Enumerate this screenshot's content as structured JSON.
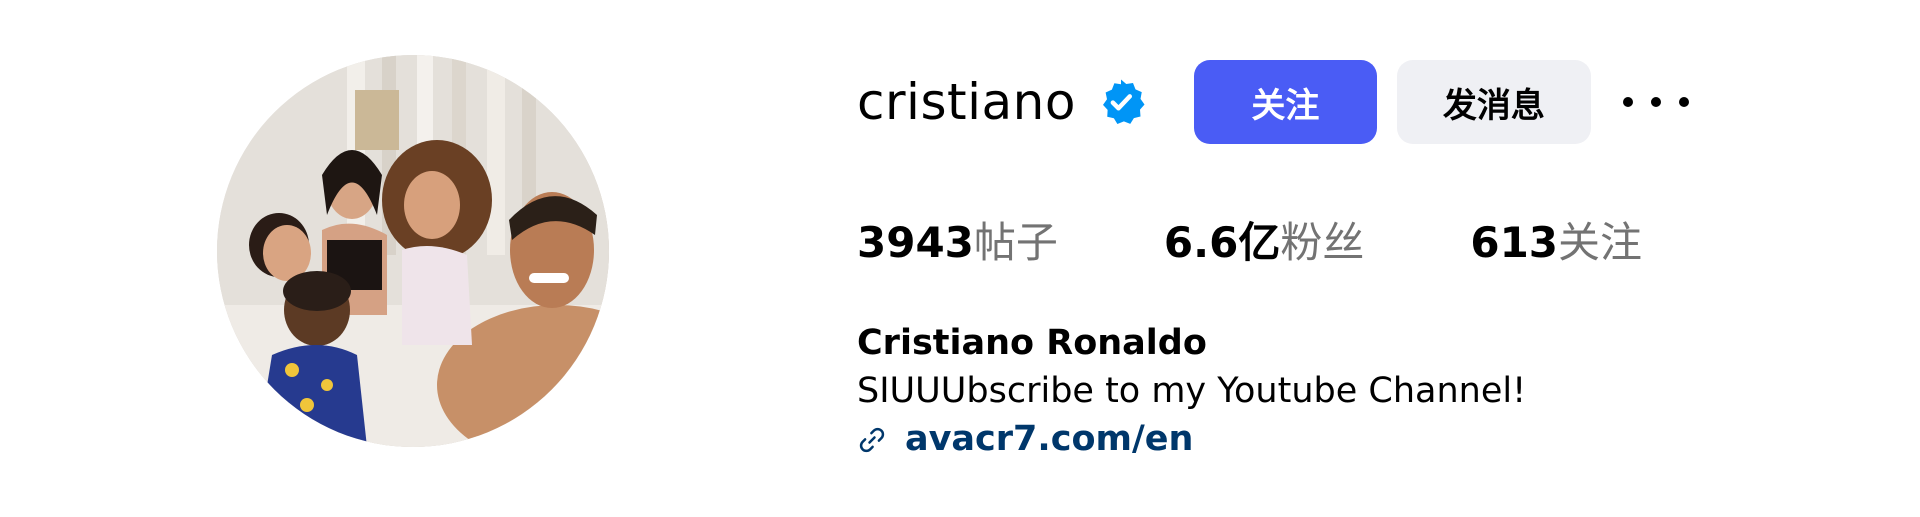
{
  "profile": {
    "username": "cristiano",
    "verified_icon": "verified-badge-icon",
    "follow_label": "关注",
    "message_label": "发消息",
    "more_icon": "more-options-icon",
    "avatar_icon": "profile-avatar",
    "stats": {
      "posts_count": "3943",
      "posts_label": "帖子",
      "followers_count": "6.6亿",
      "followers_label": "粉丝",
      "following_count": "613",
      "following_label": "关注"
    },
    "full_name": "Cristiano Ronaldo",
    "bio": "SIUUUbscribe to my Youtube Channel!",
    "link_icon": "link-icon",
    "link": "avacr7.com/en"
  },
  "colors": {
    "follow_button": "#4a5cf5",
    "message_button": "#eff0f4",
    "verified_badge": "#0095f6",
    "link_text": "#00376b",
    "muted_text": "#737373"
  }
}
